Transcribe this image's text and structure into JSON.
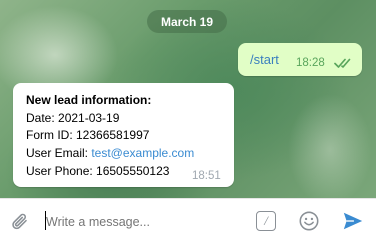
{
  "chat": {
    "date_label": "March 19",
    "outgoing": {
      "text": "/start",
      "time": "18:28",
      "status": "read"
    },
    "incoming": {
      "heading": "New lead information:",
      "date_line": "Date: 2021-03-19",
      "form_line": "Form ID: 12366581997",
      "email_label": "User Email: ",
      "email_value": "test@example.com",
      "phone_line": "User Phone:  16505550123",
      "time": "18:51"
    }
  },
  "composer": {
    "placeholder": "Write a message...",
    "command_symbol": "/"
  },
  "icons": {
    "attach": "paperclip-icon",
    "commands": "slash-command-icon",
    "emoji": "emoji-icon",
    "send": "send-icon",
    "read_receipt": "double-check-icon"
  },
  "colors": {
    "outgoing_bubble": "#e1fec6",
    "link": "#3a8bd1",
    "send_accent": "#3a8bd1",
    "read_check": "#59a55c"
  }
}
